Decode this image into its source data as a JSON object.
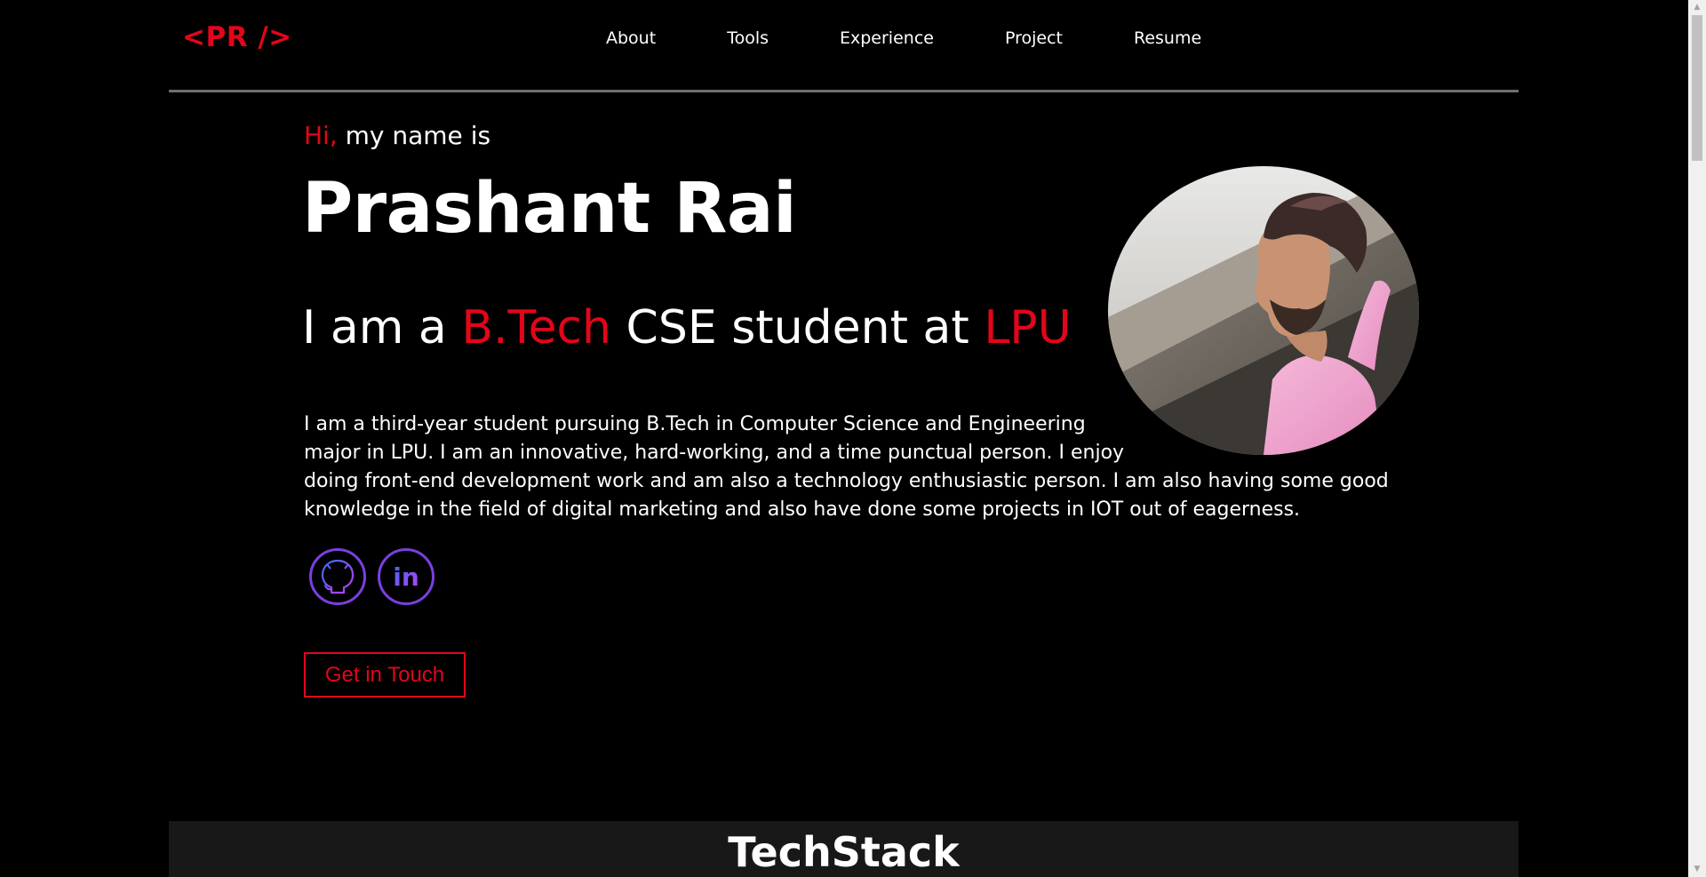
{
  "header": {
    "logo": "<PR />",
    "nav": [
      "About",
      "Tools",
      "Experience",
      "Project",
      "Resume"
    ]
  },
  "hero": {
    "greeting_accent": "Hi,",
    "greeting_rest": " my name is",
    "name": "Prashant Rai",
    "role_prefix": "I am a ",
    "role_degree": "B.Tech",
    "role_mid": " CSE student at ",
    "role_school": "LPU",
    "about_lines": [
      "I am a third-year student pursuing B.Tech in Computer Science and Engineering",
      "major in LPU. I am an innovative, hard-working, and a time punctual person. I enjoy",
      "doing front-end development work and am also a technology enthusiastic person. I am also having some good",
      "knowledge in the field of digital marketing and also have done some projects in IOT out of eagerness."
    ],
    "socials": [
      {
        "icon": "github-icon"
      },
      {
        "icon": "linkedin-icon",
        "text": "in"
      }
    ],
    "cta_label": "Get in Touch"
  },
  "techstack": {
    "title": "TechStack"
  },
  "colors": {
    "accent": "#e3051a",
    "background": "#000000",
    "social_gradient_start": "#3b6cf5",
    "social_gradient_end": "#c13bf0"
  }
}
